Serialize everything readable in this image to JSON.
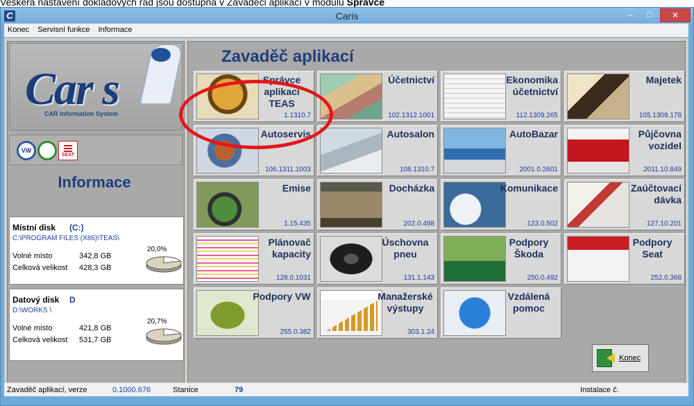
{
  "caption": {
    "prefix": "Veškerá nastavení dokladových řad jsou dostupná v Zavaděči aplikací v modulu ",
    "bold": "Správce"
  },
  "window": {
    "title": "Caris",
    "app_icon": "C",
    "controls": {
      "minimize": "–",
      "maximize": "□",
      "close": "✕"
    }
  },
  "menu": [
    "Konec",
    "Servisní funkce",
    "Informace"
  ],
  "logo": {
    "word": "Car s",
    "subtitle": "CAR Information System"
  },
  "brands": [
    "VW",
    "ŠKODA",
    "SEAT"
  ],
  "info_title": "Informace",
  "disks": {
    "local": {
      "name": "Místní disk",
      "letter": "(C:)",
      "path": "C:\\PROGRAM FILES (X86)\\TEAS\\",
      "free_label": "Volné místo",
      "free_value": "342,8 GB",
      "total_label": "Celková velikost",
      "total_value": "428,3 GB",
      "percent": "20,0%",
      "used_fraction": 0.2
    },
    "data": {
      "name": "Datový disk",
      "letter": "D",
      "path": "D:\\WORKS \\",
      "free_label": "Volné místo",
      "free_value": "421,8 GB",
      "total_label": "Celková velikost",
      "total_value": "531,7 GB",
      "percent": "20,7%",
      "used_fraction": 0.207
    }
  },
  "main_title": "Zavaděč aplikací",
  "tiles": [
    {
      "name": "Správce aplikací TEAS",
      "version": "1.1310.7"
    },
    {
      "name": "Účetnictví",
      "version": "102.1312.1001"
    },
    {
      "name": "Ekonomika účetnictví",
      "version": "112.1309.265"
    },
    {
      "name": "Majetek",
      "version": "105.1309.178"
    },
    {
      "name": "Autoservis",
      "version": "106.1311.1003"
    },
    {
      "name": "Autosalon",
      "version": "108.1310.7"
    },
    {
      "name": "AutoBazar",
      "version": "2001.0.2601"
    },
    {
      "name": "Půjčovna vozidel",
      "version": "2011.10.849"
    },
    {
      "name": "Emise",
      "version": "1.15.435"
    },
    {
      "name": "Docházka",
      "version": "202.0.498"
    },
    {
      "name": "Komunikace",
      "version": "123.0.502"
    },
    {
      "name": "Zaúčtovací dávka",
      "version": "127.10.201"
    },
    {
      "name": "Plánovač kapacity",
      "version": "128.0.1031"
    },
    {
      "name": "Úschovna pneu",
      "version": "131.1.143"
    },
    {
      "name": "Podpory Škoda",
      "version": "250.0.492"
    },
    {
      "name": "Podpory Seat",
      "version": "252.0.368"
    },
    {
      "name": "Podpory VW",
      "version": "255.0.382"
    },
    {
      "name": "Manažerské výstupy",
      "version": "303.1.24"
    },
    {
      "name": "Vzdálená pomoc",
      "version": ""
    }
  ],
  "exit_button": "Konec",
  "status": {
    "loader_label": "Zavaděč aplikací, verze",
    "loader_version": "0.1000.676",
    "station_label": "Stanice",
    "station_value": "79",
    "install_label": "Instalace č."
  },
  "colors": {
    "accent": "#1d3e7b",
    "highlight": "#e5161a",
    "panel": "#a9a9a9"
  }
}
